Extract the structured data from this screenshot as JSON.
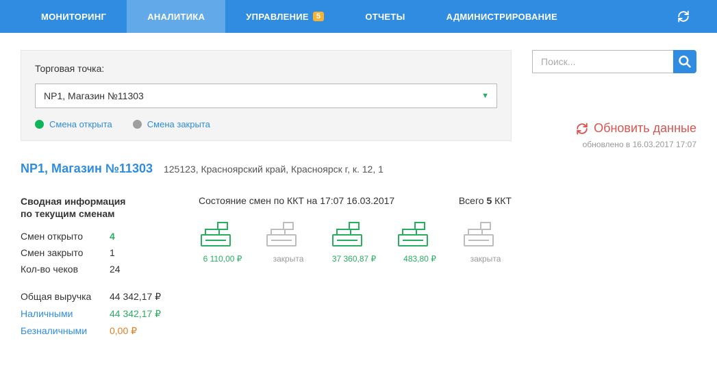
{
  "nav": {
    "monitoring": "МОНИТОРИНГ",
    "analytics": "АНАЛИТИКА",
    "management": "УПРАВЛЕНИЕ",
    "management_badge": "5",
    "reports": "ОТЧЕТЫ",
    "admin": "АДМИНИСТРИРОВАНИЕ"
  },
  "panel": {
    "label": "Торговая точка:",
    "selected": "NP1, Магазин №11303",
    "legend_open": "Смена открыта",
    "legend_closed": "Смена закрыта"
  },
  "search": {
    "placeholder": "Поиск..."
  },
  "refresh": {
    "label": "Обновить данные",
    "timestamp": "обновлено в 16.03.2017 17:07"
  },
  "store": {
    "name": "NP1, Магазин №11303",
    "address": "125123, Красноярский край, Красноярск г, к. 12, 1"
  },
  "summary": {
    "title_line1": "Сводная информация",
    "title_line2": "по текущим сменам",
    "rows": {
      "open_label": "Смен открыто",
      "open_val": "4",
      "closed_label": "Смен закрыто",
      "closed_val": "1",
      "checks_label": "Кол-во чеков",
      "checks_val": "24",
      "total_label": "Общая выручка",
      "total_val": "44 342,17 ₽",
      "cash_label": "Наличными",
      "cash_val": "44 342,17 ₽",
      "noncash_label": "Безналичными",
      "noncash_val": "0,00 ₽"
    }
  },
  "kkt": {
    "title": "Состояние смен по ККТ на 17:07 16.03.2017",
    "total_prefix": "Всего ",
    "total_count": "5",
    "total_suffix": " ККТ",
    "items": [
      {
        "status": "open",
        "value": "6 110,00 ₽"
      },
      {
        "status": "closed",
        "value": "закрыта"
      },
      {
        "status": "open",
        "value": "37 360,87 ₽"
      },
      {
        "status": "open",
        "value": "483,80 ₽"
      },
      {
        "status": "closed",
        "value": "закрыта"
      }
    ]
  }
}
